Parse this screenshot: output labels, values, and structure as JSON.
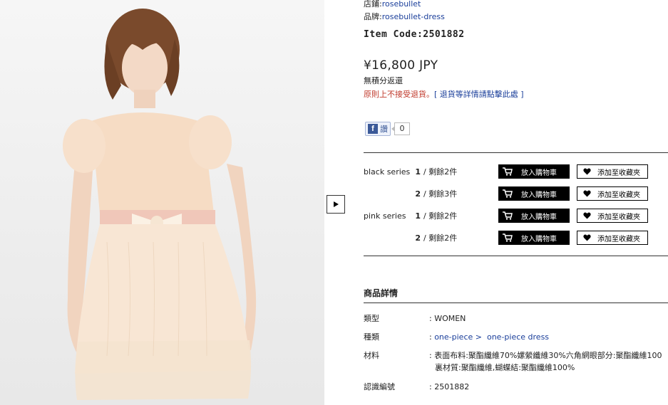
{
  "shop": {
    "label": "店鋪:",
    "value": "rosebullet"
  },
  "brand": {
    "label": "品牌:",
    "value": "rosebullet-dress"
  },
  "item_code": "Item Code:2501882",
  "price": "¥16,800 JPY",
  "shipping": "無積分返還",
  "return_policy": {
    "text": "原則上不接受退貨。",
    "link": "[ 退貨等詳情請點擊此處 ]"
  },
  "like": {
    "label": "讚",
    "count": "0",
    "fb_letter": "f"
  },
  "variants": [
    {
      "series": "black series",
      "num": "1",
      "stock": "/ 剩餘2件",
      "cart": "放入購物車",
      "fav": "添加至收藏夾"
    },
    {
      "series": "",
      "num": "2",
      "stock": "/ 剩餘3件",
      "cart": "放入購物車",
      "fav": "添加至收藏夾"
    },
    {
      "series": "pink series",
      "num": "1",
      "stock": "/ 剩餘2件",
      "cart": "放入購物車",
      "fav": "添加至收藏夾"
    },
    {
      "series": "",
      "num": "2",
      "stock": "/ 剩餘2件",
      "cart": "放入購物車",
      "fav": "添加至收藏夾"
    }
  ],
  "details": {
    "title": "商品詳情",
    "rows": [
      {
        "label": "類型",
        "value": ": WOMEN"
      },
      {
        "label": "種類",
        "value_prefix": ": ",
        "link1": "one-piece >",
        "link2": "one-piece dress"
      },
      {
        "label": "材料",
        "line1": ": 表面布料:聚酯纖維70%嫘縈纖維30%六角網眼部分:聚酯纖維100",
        "line2": "裏材質:聚酯纖維,蝴蝶結:聚酯纖維100%"
      },
      {
        "label": "認識編號",
        "value": ": 2501882"
      }
    ]
  },
  "icons": {
    "next": "play-triangle-icon",
    "cart": "cart-icon",
    "heart": "heart-icon",
    "facebook": "facebook-icon"
  },
  "colors": {
    "link": "#1a3e9a",
    "warning": "#c0392b",
    "button_dark": "#000000",
    "fb_blue": "#3b5998"
  }
}
